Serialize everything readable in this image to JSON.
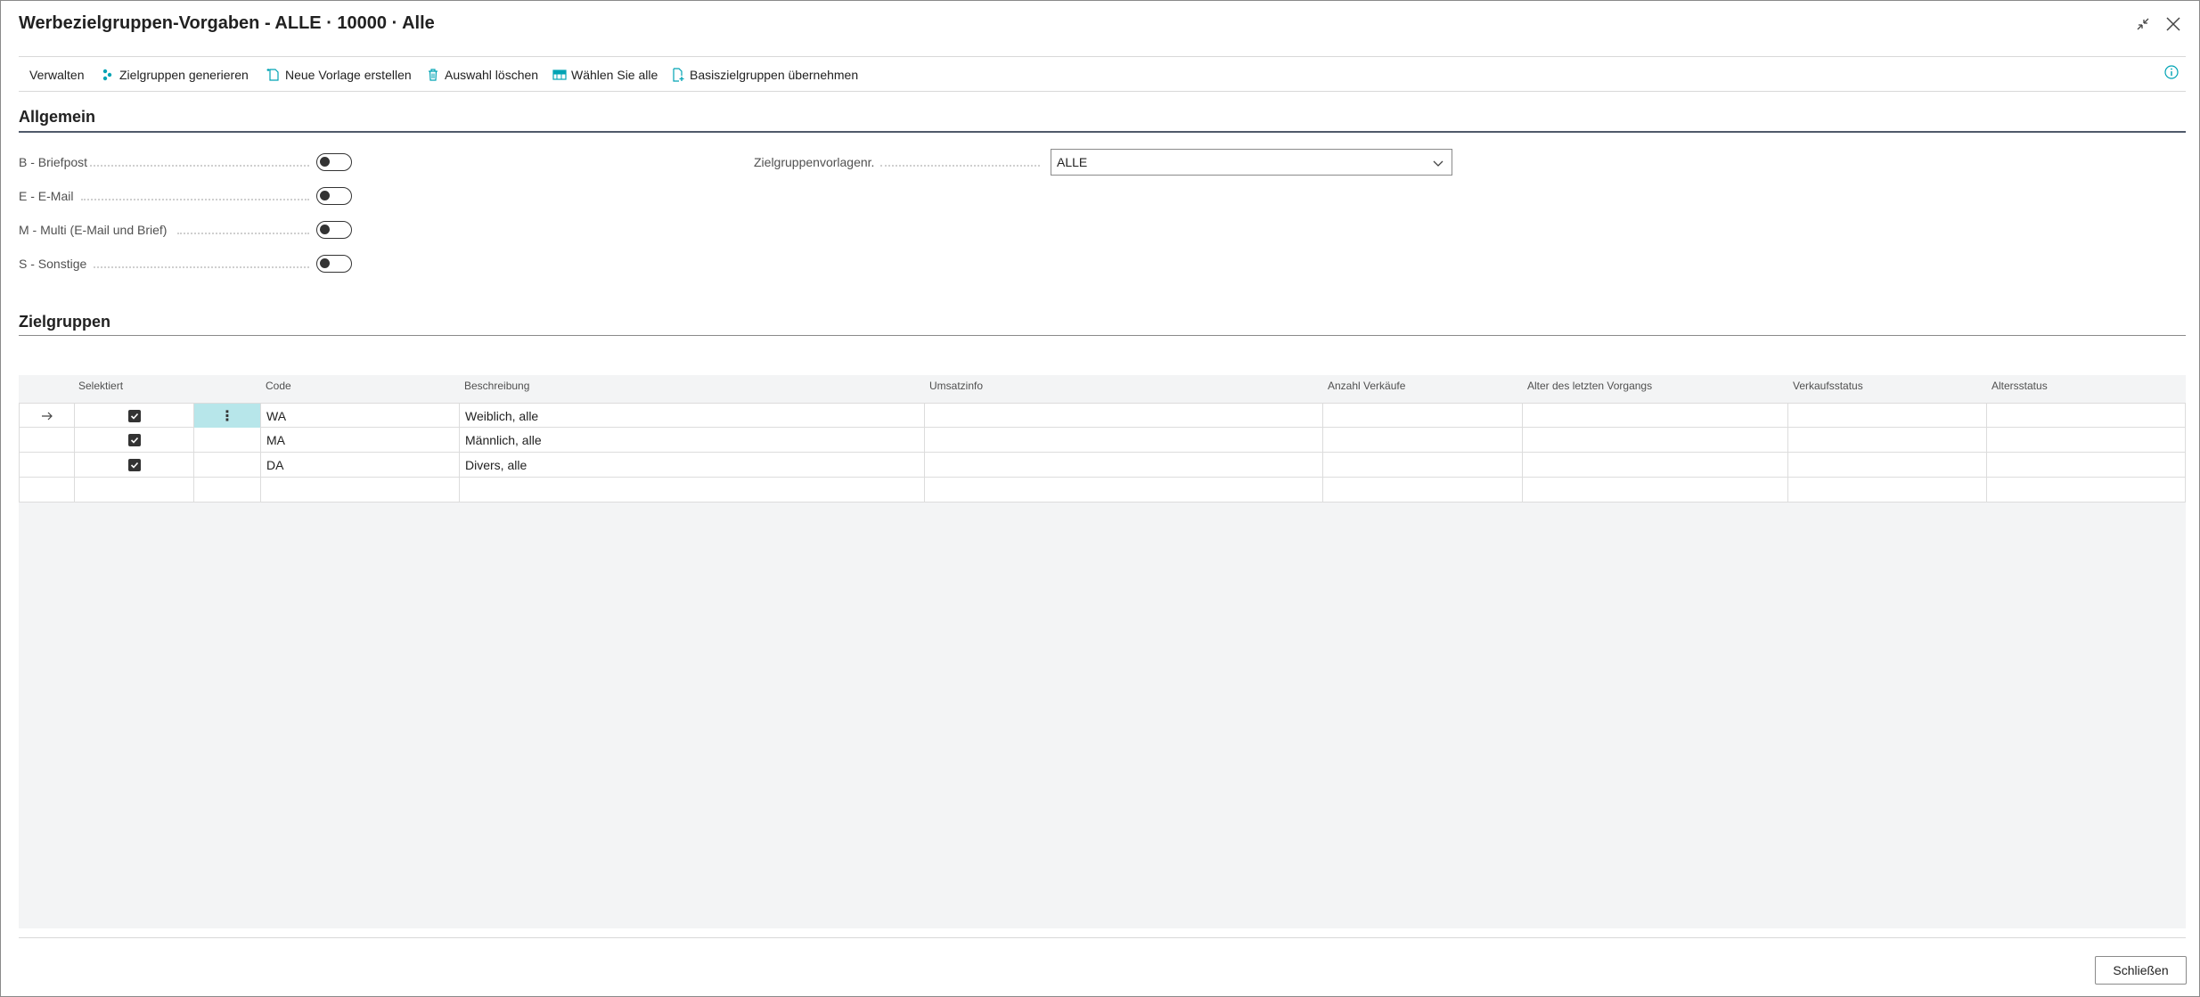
{
  "window": {
    "title": "Werbezielgruppen-Vorgaben - ALLE · 10000 · Alle"
  },
  "toolbar": {
    "manage_label": "Verwalten",
    "generate_label": "Zielgruppen generieren",
    "new_template_label": "Neue Vorlage erstellen",
    "clear_selection_label": "Auswahl löschen",
    "select_all_label": "Wählen Sie alle",
    "apply_base_label": "Basiszielgruppen übernehmen"
  },
  "general": {
    "title": "Allgemein",
    "fields": [
      {
        "label": "B - Briefpost",
        "value": false
      },
      {
        "label": "E - E-Mail",
        "value": false
      },
      {
        "label": "M - Multi (E-Mail und Brief)",
        "value": false
      },
      {
        "label": "S - Sonstige",
        "value": false
      }
    ],
    "template_no_label": "Zielgruppenvorlagenr.",
    "template_no_value": "ALLE"
  },
  "targets": {
    "title": "Zielgruppen",
    "columns": {
      "selected": "Selektiert",
      "code": "Code",
      "description": "Beschreibung",
      "revenue_info": "Umsatzinfo",
      "sales_count": "Anzahl Verkäufe",
      "last_transaction_age": "Alter des letzten Vorgangs",
      "sales_status": "Verkaufsstatus",
      "age_status": "Altersstatus"
    },
    "rows": [
      {
        "selected": true,
        "code": "WA",
        "description": "Weiblich, alle"
      },
      {
        "selected": true,
        "code": "MA",
        "description": "Männlich, alle"
      },
      {
        "selected": true,
        "code": "DA",
        "description": "Divers, alle"
      }
    ]
  },
  "footer": {
    "close_label": "Schließen"
  },
  "colors": {
    "accent": "#00a3b4",
    "selected_cell": "#b7e6ea",
    "section_line": "#505a6a"
  }
}
